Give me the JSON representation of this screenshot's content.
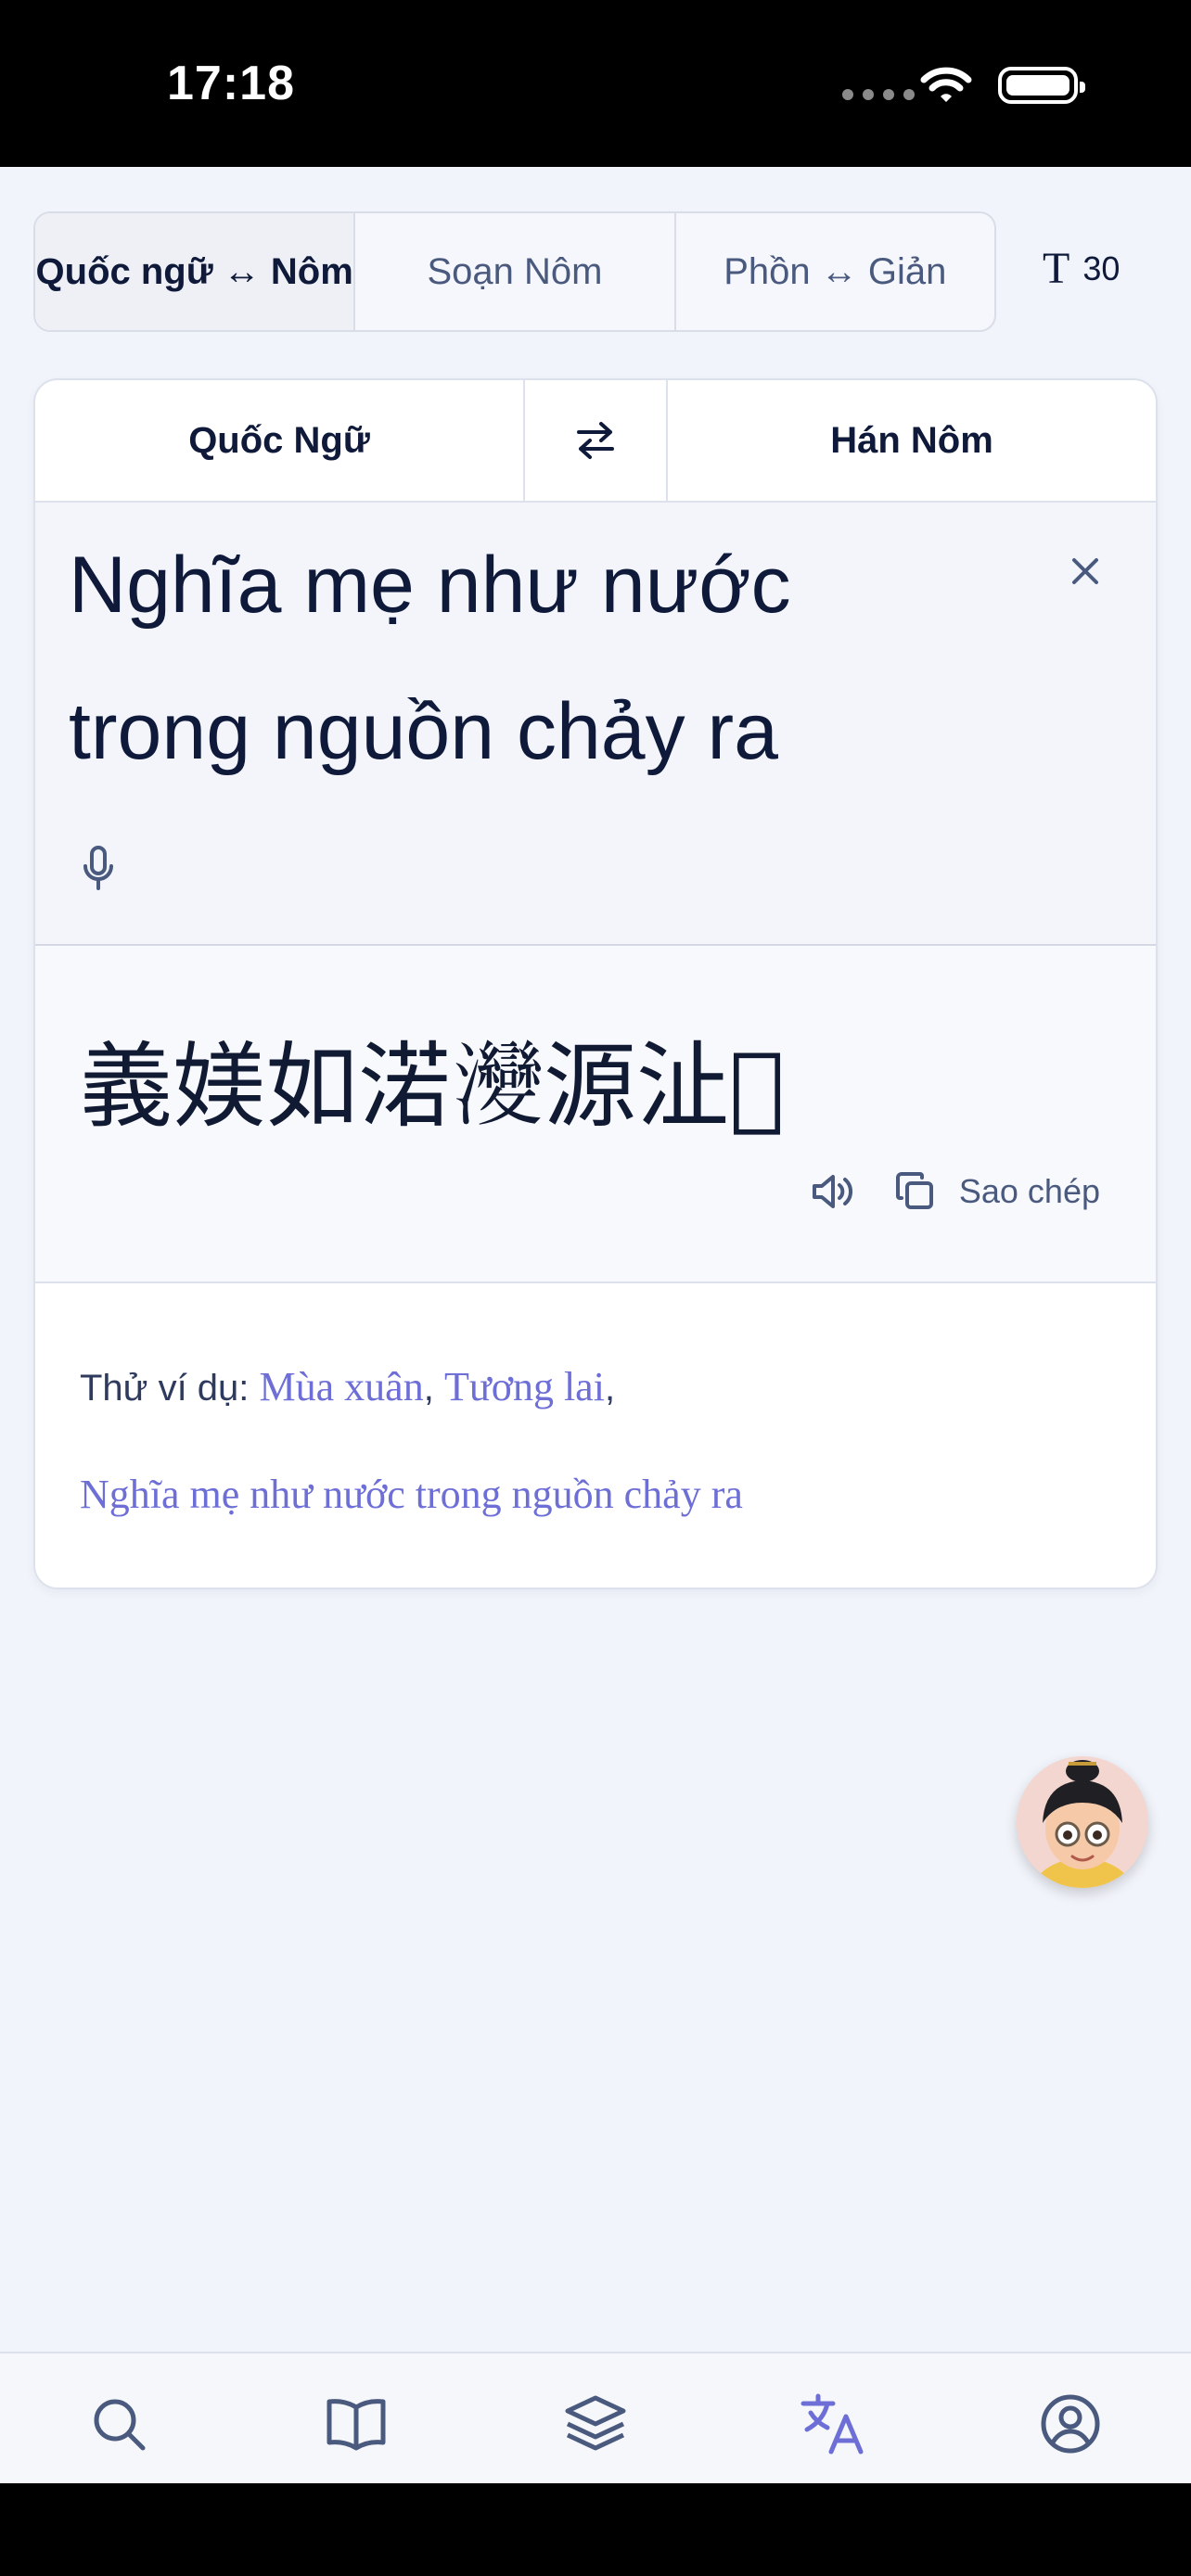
{
  "status_bar": {
    "time": "17:18"
  },
  "mode_tabs": [
    {
      "label": "Quốc ngữ ↔ Nôm"
    },
    {
      "label": "Soạn Nôm"
    },
    {
      "label": "Phồn ↔ Giản"
    }
  ],
  "font_size": {
    "icon_glyph": "T",
    "value": "30"
  },
  "translator": {
    "source_lang": "Quốc Ngữ",
    "target_lang": "Hán Nôm",
    "input_line1": "Nghĩa mẹ như nước",
    "input_line2": "trong nguồn chảy ra",
    "output_text": "義媄如渃𤅶源沚𪽕",
    "copy_label": "Sao chép"
  },
  "examples": {
    "label": "Thử ví dụ:",
    "items": [
      "Mùa xuân",
      "Tương lai",
      "Nghĩa mẹ như nước trong nguồn chảy ra"
    ]
  },
  "tab_bar": {
    "items": [
      {
        "icon": "search-icon"
      },
      {
        "icon": "book-icon"
      },
      {
        "icon": "layers-icon"
      },
      {
        "icon": "translate-icon"
      },
      {
        "icon": "user-icon"
      }
    ],
    "active_color": "#6d6fd6",
    "inactive_color": "#4a5a7e"
  }
}
